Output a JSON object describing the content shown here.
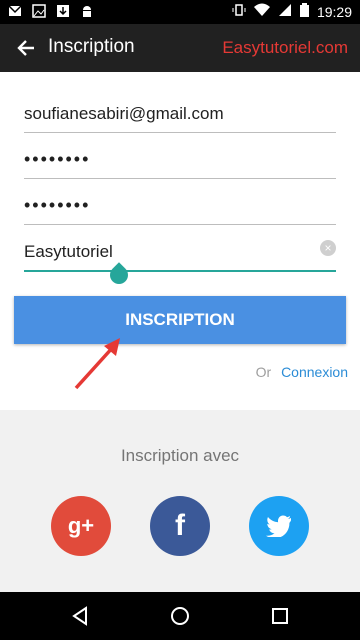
{
  "status_bar": {
    "time": "19:29",
    "icons": [
      "gmail-icon",
      "gallery-icon",
      "download-icon",
      "android-icon",
      "vibrate-icon",
      "wifi-icon",
      "signal-icon",
      "battery-icon"
    ]
  },
  "app_bar": {
    "title": "Inscription",
    "brand": "Easytutoriel.com"
  },
  "form": {
    "email": "soufianesabiri@gmail.com",
    "password": "••••••••",
    "confirm_password": "••••••••",
    "username": "Easytutoriel",
    "submit_label": "INSCRIPTION",
    "or_label": "Or",
    "login_link": "Connexion"
  },
  "social": {
    "title": "Inscription avec",
    "google_label": "g+",
    "facebook_label": "f",
    "twitter_label": "t"
  },
  "colors": {
    "accent": "#26a69a",
    "button": "#4a90e2",
    "brand": "#e53935",
    "google": "#e14b3b",
    "facebook": "#3b5998",
    "twitter": "#1da1f2"
  }
}
